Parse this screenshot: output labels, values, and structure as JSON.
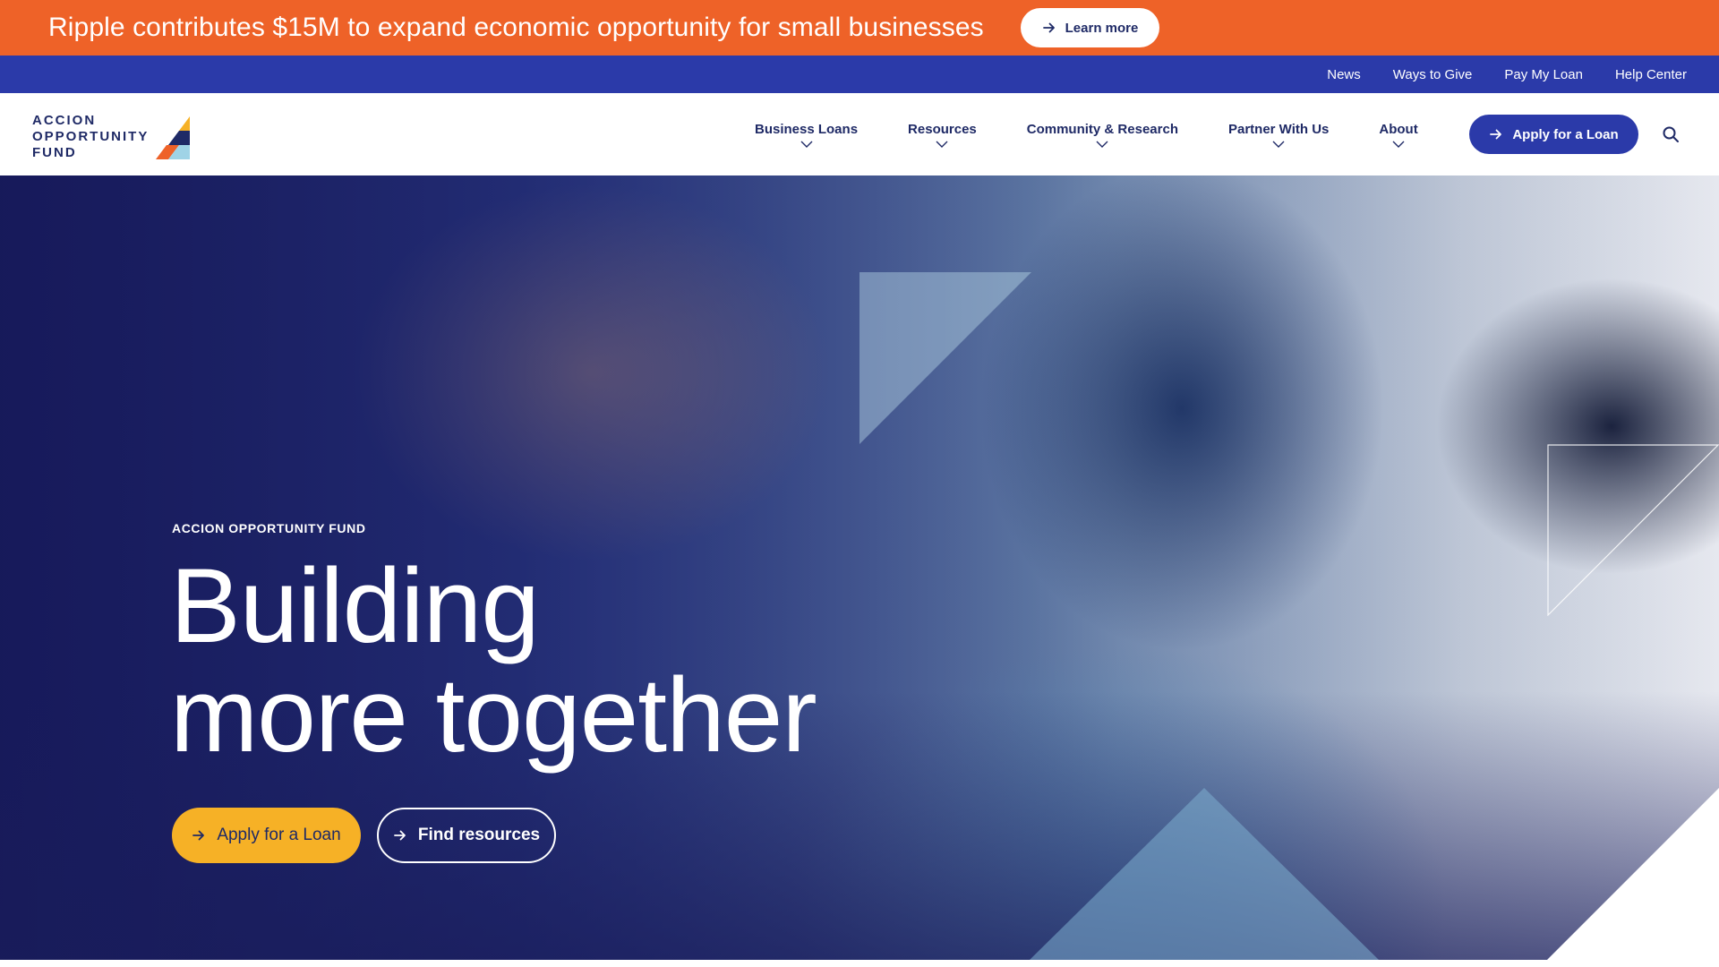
{
  "announcement": {
    "text": "Ripple contributes $15M to expand economic opportunity for small businesses",
    "button_label": "Learn more",
    "background": "#ee6228"
  },
  "utility_nav": {
    "links": [
      "News",
      "Ways to Give",
      "Pay My Loan",
      "Help Center"
    ],
    "background": "#2b3aa9"
  },
  "brand": {
    "logo_lines": [
      "ACCION",
      "OPPORTUNITY",
      "FUND"
    ],
    "colors": {
      "navy": "#1f2a66",
      "yellow": "#f6b126",
      "orange": "#ee6228",
      "light_blue": "#9fd3e6"
    }
  },
  "main_nav": {
    "items": [
      "Business Loans",
      "Resources",
      "Community & Research",
      "Partner With Us",
      "About"
    ],
    "cta_label": "Apply for a Loan",
    "search_icon": "search-icon"
  },
  "hero": {
    "eyebrow": "ACCION OPPORTUNITY FUND",
    "title_line1": "Building",
    "title_line2": "more together",
    "primary_button": "Apply for a Loan",
    "secondary_button": "Find resources"
  }
}
